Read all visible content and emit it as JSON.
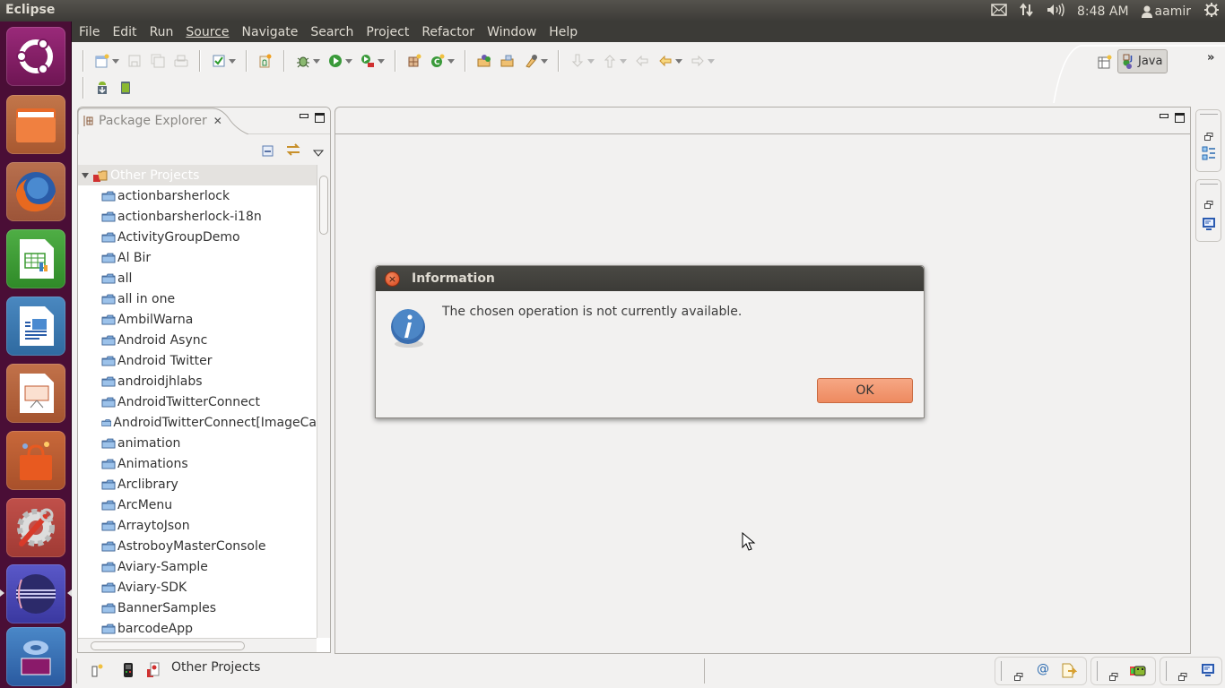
{
  "topbar": {
    "app_title": "Eclipse",
    "time": "8:48 AM",
    "user": "aamir",
    "indicators": [
      "mail-icon",
      "network-icon",
      "volume-icon",
      "user-icon",
      "power-icon"
    ]
  },
  "launcher": {
    "items": [
      {
        "name": "Dash Home",
        "icon": "ubuntu-icon",
        "color": "#8a1e6a"
      },
      {
        "name": "Files",
        "icon": "folder-icon",
        "color": "#b05a2a"
      },
      {
        "name": "Firefox",
        "icon": "firefox-icon",
        "color": "#a4593a"
      },
      {
        "name": "LibreOffice Calc",
        "icon": "calc-icon",
        "color": "#3f9b3a"
      },
      {
        "name": "LibreOffice Writer",
        "icon": "writer-icon",
        "color": "#3a74a8"
      },
      {
        "name": "LibreOffice Impress",
        "icon": "impress-icon",
        "color": "#b35b35"
      },
      {
        "name": "Ubuntu Software Center",
        "icon": "software-center-icon",
        "color": "#b8562e"
      },
      {
        "name": "System Settings",
        "icon": "settings-icon",
        "color": "#b5423a"
      },
      {
        "name": "Eclipse",
        "icon": "eclipse-icon",
        "color": "#4b48b0"
      },
      {
        "name": "Workspaces",
        "icon": "workspace-icon",
        "color": "#3d79b5"
      }
    ]
  },
  "menubar": {
    "items": [
      {
        "label": "File"
      },
      {
        "label": "Edit"
      },
      {
        "label": "Run"
      },
      {
        "label": "Source"
      },
      {
        "label": "Navigate"
      },
      {
        "label": "Search"
      },
      {
        "label": "Project"
      },
      {
        "label": "Refactor"
      },
      {
        "label": "Window"
      },
      {
        "label": "Help"
      }
    ]
  },
  "toolbar": {
    "row1": [
      "new-icon",
      "save-icon",
      "save-all-icon",
      "print-icon",
      "task-icon",
      "new-android-project-icon",
      "debug-icon",
      "run-icon",
      "external-tools-icon",
      "new-java-package-icon",
      "new-java-class-icon",
      "open-type-icon",
      "open-task-icon",
      "search-icon",
      "next-annotation-icon",
      "previous-annotation-icon",
      "last-edit-icon",
      "back-icon",
      "forward-icon"
    ],
    "row2": [
      "android-sdk-manager-icon",
      "android-avd-manager-icon"
    ],
    "perspective_label": "Java"
  },
  "package_explorer": {
    "title": "Package Explorer",
    "root": "Other Projects",
    "projects": [
      "actionbarsherlock",
      "actionbarsherlock-i18n",
      "ActivityGroupDemo",
      "Al Bir",
      "all",
      "all in one",
      "AmbilWarna",
      "Android Async",
      "Android Twitter",
      "androidjhlabs",
      "AndroidTwitterConnect",
      "AndroidTwitterConnect[ImageCa",
      "animation",
      "Animations",
      "Arclibrary",
      "ArcMenu",
      "ArraytoJson",
      "AstroboyMasterConsole",
      "Aviary-Sample",
      "Aviary-SDK",
      "BannerSamples",
      "barcodeApp"
    ]
  },
  "status_bar": {
    "selection": "Other Projects"
  },
  "dialog": {
    "title": "Information",
    "message": "The chosen operation is not currently available.",
    "ok_label": "OK"
  }
}
